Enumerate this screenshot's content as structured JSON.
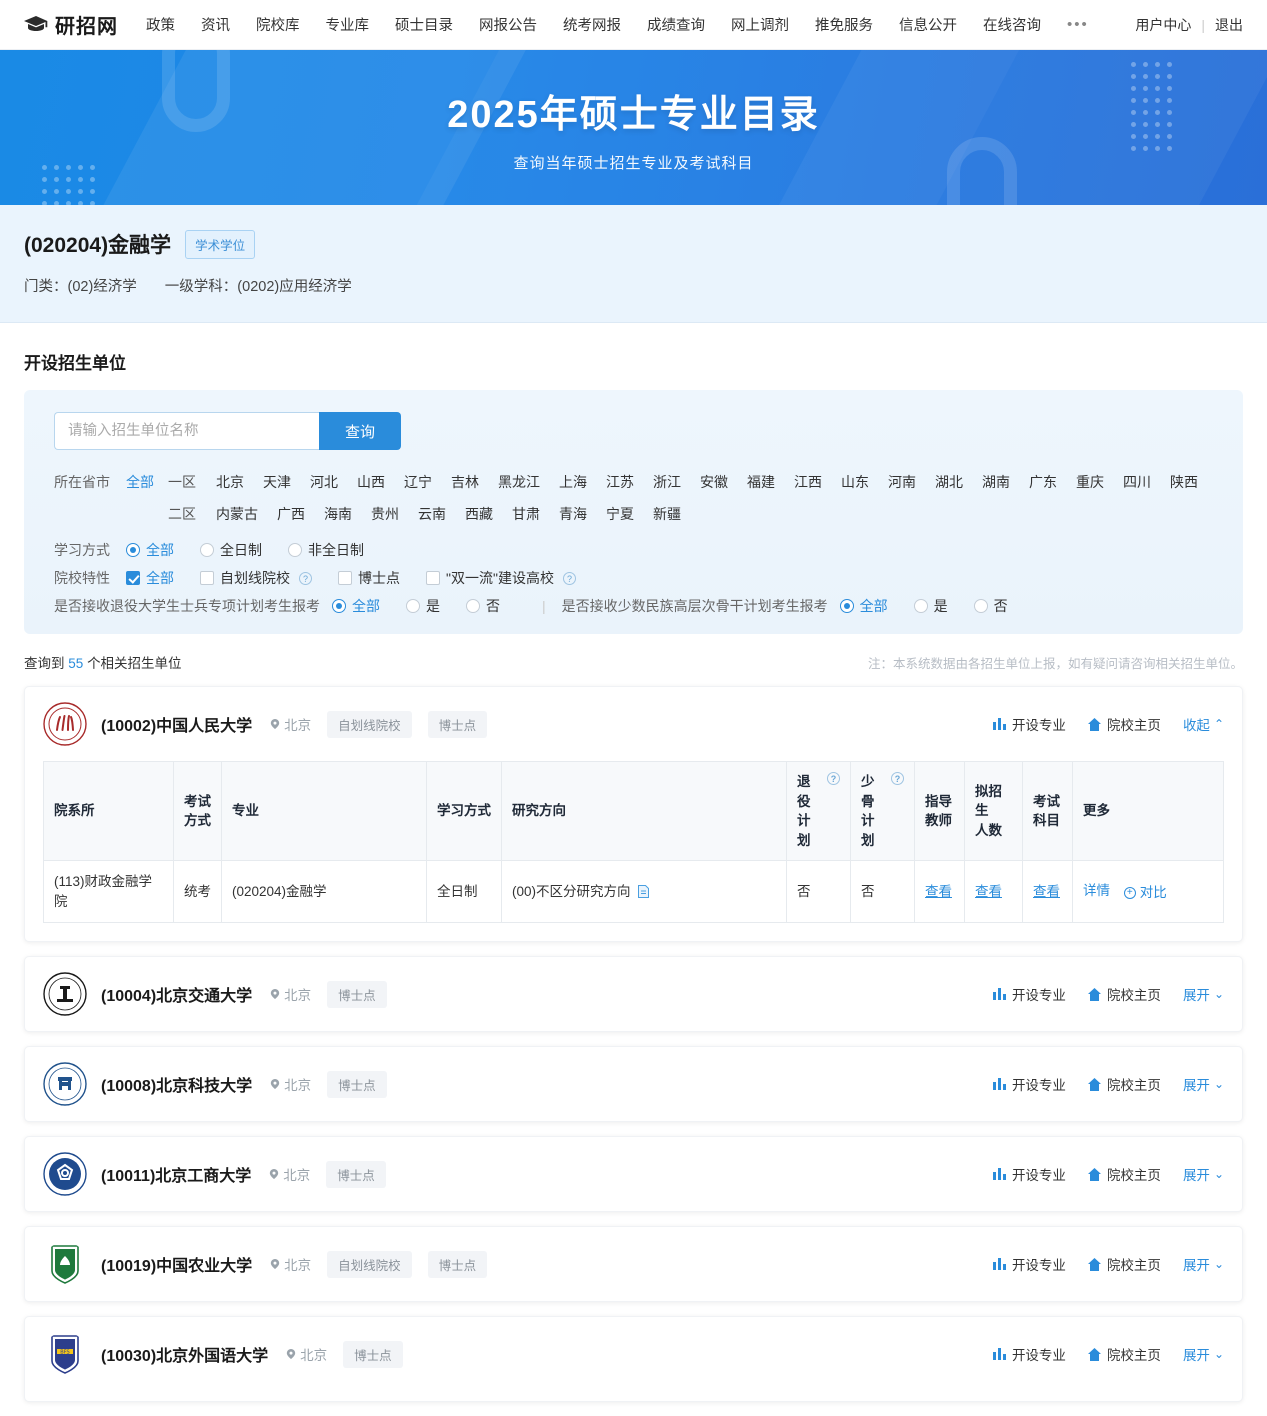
{
  "nav": {
    "brand": "研招网",
    "brand_icon": "graduation-cap-icon",
    "links": [
      "政策",
      "资讯",
      "院校库",
      "专业库",
      "硕士目录",
      "网报公告",
      "统考网报",
      "成绩查询",
      "网上调剂",
      "推免服务",
      "信息公开",
      "在线咨询"
    ],
    "more": "•••",
    "user_center": "用户中心",
    "separator": "|",
    "logout": "退出"
  },
  "banner": {
    "title": "2025年硕士专业目录",
    "subtitle": "查询当年硕士招生专业及考试科目",
    "bg_color": "#1f86e8"
  },
  "major": {
    "title": "(020204)金融学",
    "degree_badge": "学术学位",
    "category_label": "门类：(02)经济学",
    "first_level_label": "一级学科：(0202)应用经济学"
  },
  "search_section": {
    "title": "开设招生单位",
    "input_placeholder": "请输入招生单位名称",
    "input_value": "",
    "search_button": "查询"
  },
  "filters": {
    "province_label": "所在省市",
    "all_label": "全部",
    "zone1_label": "一区",
    "zone2_label": "二区",
    "zone1_provinces": [
      "北京",
      "天津",
      "河北",
      "山西",
      "辽宁",
      "吉林",
      "黑龙江",
      "上海",
      "江苏",
      "浙江",
      "安徽",
      "福建",
      "江西",
      "山东",
      "河南",
      "湖北",
      "湖南",
      "广东",
      "重庆",
      "四川",
      "陕西"
    ],
    "zone2_provinces": [
      "内蒙古",
      "广西",
      "海南",
      "贵州",
      "云南",
      "西藏",
      "甘肃",
      "青海",
      "宁夏",
      "新疆"
    ],
    "study_mode_label": "学习方式",
    "study_mode_options": [
      {
        "label": "全部",
        "selected": true
      },
      {
        "label": "全日制",
        "selected": false
      },
      {
        "label": "非全日制",
        "selected": false
      }
    ],
    "school_feature_label": "院校特性",
    "school_feature_options": [
      {
        "label": "全部",
        "checked": true,
        "help": false
      },
      {
        "label": "自划线院校",
        "checked": false,
        "help": true
      },
      {
        "label": "博士点",
        "checked": false,
        "help": false
      },
      {
        "label": "\"双一流\"建设高校",
        "checked": false,
        "help": true
      }
    ],
    "veteran_label": "是否接收退役大学生士兵专项计划考生报考",
    "veteran_options": [
      {
        "label": "全部",
        "selected": true
      },
      {
        "label": "是",
        "selected": false
      },
      {
        "label": "否",
        "selected": false
      }
    ],
    "minority_label": "是否接收少数民族高层次骨干计划考生报考",
    "minority_options": [
      {
        "label": "全部",
        "selected": true
      },
      {
        "label": "是",
        "selected": false
      },
      {
        "label": "否",
        "selected": false
      }
    ],
    "divider": "|"
  },
  "results": {
    "count_prefix": "查询到",
    "count": "55",
    "count_suffix": "个相关招生单位",
    "note": "注：本系统数据由各招生单位上报，如有疑问请咨询相关招生单位。",
    "action_majors": "开设专业",
    "action_homepage": "院校主页",
    "action_collapse": "收起",
    "action_expand": "展开"
  },
  "table": {
    "headers": [
      {
        "label": "院系所",
        "help": false
      },
      {
        "label": "考试\n方式",
        "help": false
      },
      {
        "label": "专业",
        "help": false
      },
      {
        "label": "学习方式",
        "help": false
      },
      {
        "label": "研究方向",
        "help": false
      },
      {
        "label": "退役\n计划",
        "help": true
      },
      {
        "label": "少骨\n计划",
        "help": true
      },
      {
        "label": "指导\n教师",
        "help": false
      },
      {
        "label": "拟招生\n人数",
        "help": false
      },
      {
        "label": "考试\n科目",
        "help": false
      },
      {
        "label": "更多",
        "help": false
      }
    ],
    "rows": [
      {
        "department": "(113)财政金融学院",
        "exam_mode": "统考",
        "major": "(020204)金融学",
        "study_mode": "全日制",
        "direction": "(00)不区分研究方向",
        "direction_has_doc": true,
        "veteran": "否",
        "minority": "否",
        "advisor_link": "查看",
        "quota_link": "查看",
        "subject_link": "查看",
        "detail_link": "详情",
        "compare_link": "对比"
      }
    ]
  },
  "schools": [
    {
      "code_name": "(10002)中国人民大学",
      "city": "北京",
      "tags": [
        "自划线院校",
        "博士点"
      ],
      "expanded": true,
      "toggle_label": "收起",
      "logo_color": "#a82b2b",
      "logo_bg": "#ffffff",
      "logo_text": "中国人民大学"
    },
    {
      "code_name": "(10004)北京交通大学",
      "city": "北京",
      "tags": [
        "博士点"
      ],
      "expanded": false,
      "toggle_label": "展开",
      "logo_color": "#1a1a1a",
      "logo_bg": "#ffffff",
      "logo_text": "北京交通大学"
    },
    {
      "code_name": "(10008)北京科技大学",
      "city": "北京",
      "tags": [
        "博士点"
      ],
      "expanded": false,
      "toggle_label": "展开",
      "logo_color": "#21538c",
      "logo_bg": "#ffffff",
      "logo_text": "北京科技大学"
    },
    {
      "code_name": "(10011)北京工商大学",
      "city": "北京",
      "tags": [
        "博士点"
      ],
      "expanded": false,
      "toggle_label": "展开",
      "logo_color": "#1f4b8e",
      "logo_bg": "#ffffff",
      "logo_text": "北京工商大学"
    },
    {
      "code_name": "(10019)中国农业大学",
      "city": "北京",
      "tags": [
        "自划线院校",
        "博士点"
      ],
      "expanded": false,
      "toggle_label": "展开",
      "logo_color": "#1f7a3d",
      "logo_bg": "#ffffff",
      "logo_text": "中国农业大学"
    },
    {
      "code_name": "(10030)北京外国语大学",
      "city": "北京",
      "tags": [
        "博士点"
      ],
      "expanded": false,
      "toggle_label": "展开",
      "logo_color": "#2d3e8c",
      "logo_bg": "#ffffff",
      "logo_text": "北京外国语大学"
    }
  ]
}
